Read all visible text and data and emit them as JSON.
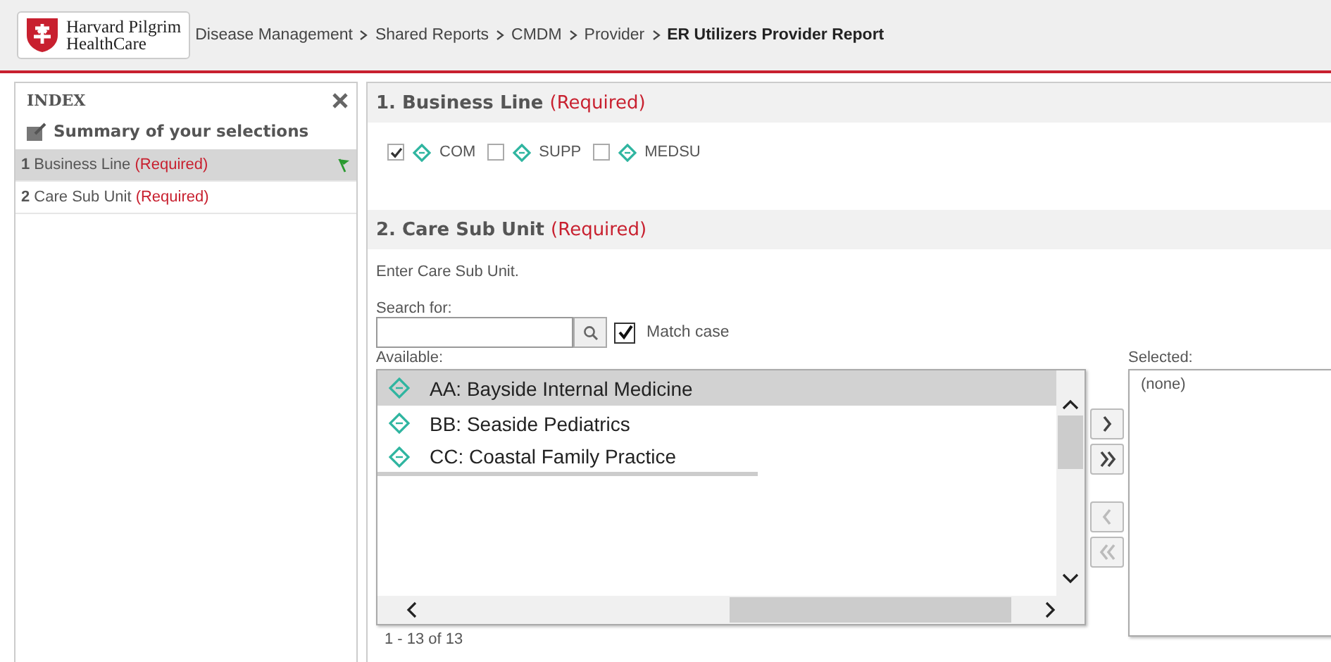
{
  "header": {
    "logo_lines": [
      "Harvard Pilgrim",
      "HealthCare"
    ],
    "breadcrumb": [
      "Disease Management",
      "Shared Reports",
      "CMDM",
      "Provider"
    ],
    "current_page": "ER Utilizers Provider Report"
  },
  "index_panel": {
    "title": "INDEX",
    "summary_link": "Summary of your selections",
    "items": [
      {
        "number": "1",
        "label": "Business Line",
        "note": "(Required)",
        "selected": true,
        "flagged": true
      },
      {
        "number": "2",
        "label": "Care Sub Unit",
        "note": "(Required)",
        "selected": false,
        "flagged": false
      }
    ]
  },
  "business_line": {
    "title": "1.  Business Line",
    "note": "(Required)",
    "options": [
      {
        "label": "COM",
        "checked": true
      },
      {
        "label": "SUPP",
        "checked": false
      },
      {
        "label": "MEDSU",
        "checked": false
      }
    ]
  },
  "care_sub_unit": {
    "title": "2.  Care Sub Unit",
    "note": "(Required)",
    "instruction": "Enter Care Sub Unit.",
    "search_label": "Search for:",
    "match_case": {
      "label": "Match case",
      "checked": true
    },
    "available_label": "Available:",
    "available": [
      {
        "label": "AA:  Bayside Internal Medicine",
        "selected": true
      },
      {
        "label": "BB:  Seaside Pediatrics",
        "selected": false
      },
      {
        "label": "CC: Coastal Family Practice",
        "selected": false
      }
    ],
    "count": "1 - 13 of 13",
    "transfer_buttons": [
      {
        "kind": "add",
        "disabled": false
      },
      {
        "kind": "add-all",
        "disabled": false
      },
      {
        "kind": "remove",
        "disabled": true
      },
      {
        "kind": "remove-all",
        "disabled": true
      }
    ],
    "selected_label": "Selected:",
    "selected_items": [
      "(none)"
    ]
  }
}
